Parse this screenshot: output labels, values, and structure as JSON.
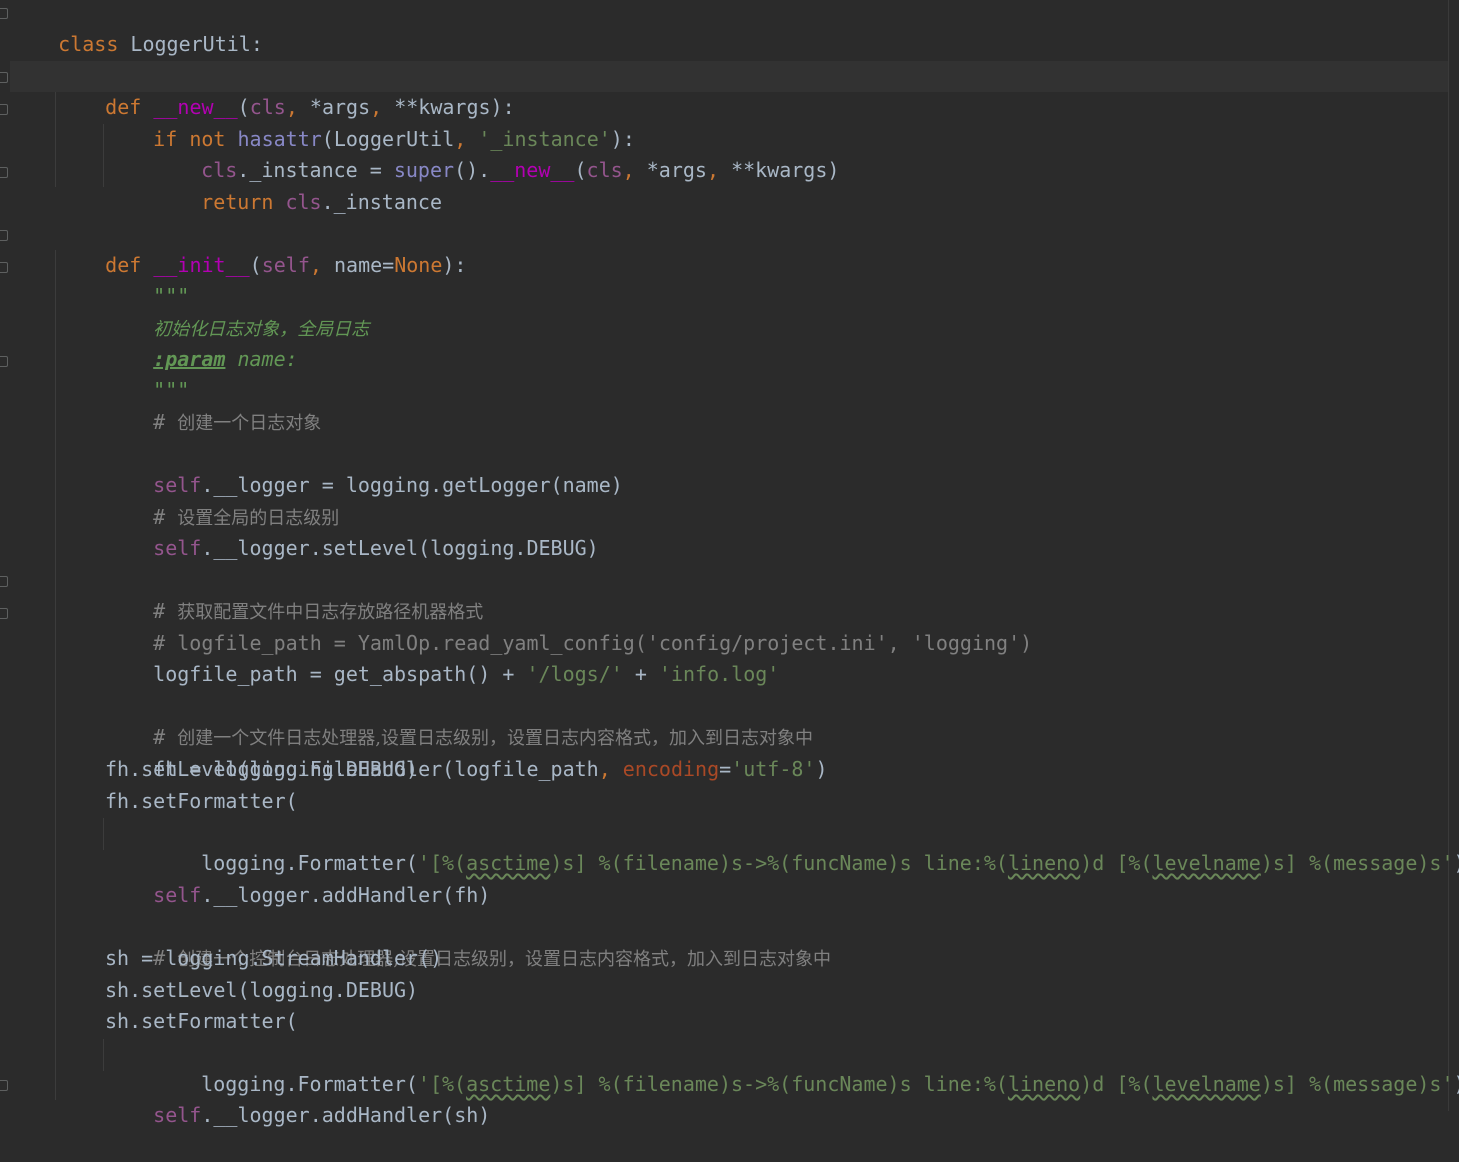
{
  "editor": {
    "theme": "darcula",
    "colors": {
      "background": "#2b2b2b",
      "text": "#a9b7c6",
      "keyword": "#cc7832",
      "magic": "#b200b2",
      "self": "#94558d",
      "string": "#6a8759",
      "builtin": "#8888c6",
      "kwarg": "#aa4926",
      "comment": "#808080",
      "docstring": "#629755"
    }
  },
  "code": {
    "l1": {
      "kw": "class",
      "name": " LoggerUtil:"
    },
    "l2": {
      "kw": "def",
      "sp": " ",
      "magic": "__new__",
      "open": "(",
      "cls": "cls",
      "comma1": ", ",
      "args": "*args",
      "comma2": ", ",
      "kwargs": "**kwargs",
      "close": "):"
    },
    "l3": {
      "kw_if": "if",
      "sp1": " ",
      "kw_not": "not",
      "sp2": " ",
      "builtin": "hasattr",
      "open": "(LoggerUtil",
      "comma": ", ",
      "str": "'_instance'",
      "close": "):"
    },
    "l4": {
      "cls": "cls",
      "mid": "._instance = ",
      "builtin": "super",
      "paren": "().",
      "magic": "__new__",
      "open": "(",
      "cls2": "cls",
      "comma1": ", ",
      "args": "*args",
      "comma2": ", ",
      "kwargs": "**kwargs)"
    },
    "l5": {
      "kw": "return",
      "sp": " ",
      "cls": "cls",
      "rest": "._instance"
    },
    "l6": {
      "kw": "def",
      "sp": " ",
      "magic": "__init__",
      "open": "(",
      "self": "self",
      "comma": ", ",
      "param": "name=",
      "none": "None",
      "close": "):"
    },
    "l7": {
      "doc": "\"\"\""
    },
    "l8": {
      "doc": "初始化日志对象，全局日志"
    },
    "l9": {
      "tag": ":param",
      "rest": " name:"
    },
    "l10": {
      "doc": "\"\"\""
    },
    "l11": {
      "hash": "# ",
      "cmt": "创建一个日志对象"
    },
    "l12": {
      "self": "self",
      "rest": ".__logger = logging.getLogger(name)"
    },
    "l13": {
      "hash": "# ",
      "cmt": "设置全局的日志级别"
    },
    "l14": {
      "self": "self",
      "rest": ".__logger.setLevel(logging.DEBUG)"
    },
    "l15": {
      "hash": "# ",
      "cmt": "获取配置文件中日志存放路径机器格式"
    },
    "l16": {
      "cmt": "# logfile_path = YamlOp.read_yaml_config('config/project.ini', 'logging')"
    },
    "l17": {
      "pre": "logfile_path = get_abspath() + ",
      "s1": "'/logs/'",
      "plus": " + ",
      "s2": "'info.log'"
    },
    "l18": {
      "hash": "# ",
      "cmt": "创建一个文件日志处理器,设置日志级别，设置日志内容格式，加入到日志对象中"
    },
    "l19": {
      "pre": "fh = logging.FileHandler(logfile_path",
      "comma": ", ",
      "kwarg": "encoding",
      "eq": "=",
      "str": "'utf-8'",
      "close": ")"
    },
    "l20": {
      "text": "fh.setLevel(logging.DEBUG)"
    },
    "l21": {
      "text": "fh.setFormatter("
    },
    "l22": {
      "pre": "logging.Formatter(",
      "s1": "'[%(",
      "u1": "asctime",
      "s2": ")s] %(filename)s->%(funcName)s line:%(",
      "u2": "lineno",
      "s3": ")d [%(",
      "u3": "levelname",
      "s4": ")s] %(message)s'",
      "close": "))"
    },
    "l23": {
      "self": "self",
      "rest": ".__logger.addHandler(fh)"
    },
    "l24": {
      "hash": "# ",
      "cmt": "创建一个控制台日志处理器,设置日志级别，设置日志内容格式，加入到日志对象中"
    },
    "l25": {
      "text": "sh = logging.StreamHandler()"
    },
    "l26": {
      "text": "sh.setLevel(logging.DEBUG)"
    },
    "l27": {
      "text": "sh.setFormatter("
    },
    "l28": {
      "pre": "logging.Formatter(",
      "s1": "'[%(",
      "u1": "asctime",
      "s2": ")s] %(filename)s->%(funcName)s line:%(",
      "u2": "lineno",
      "s3": ")d [%(",
      "u3": "levelname",
      "s4": ")s] %(message)s'",
      "close": "))"
    },
    "l29": {
      "self": "self",
      "rest": ".__logger.addHandler(sh)"
    }
  }
}
